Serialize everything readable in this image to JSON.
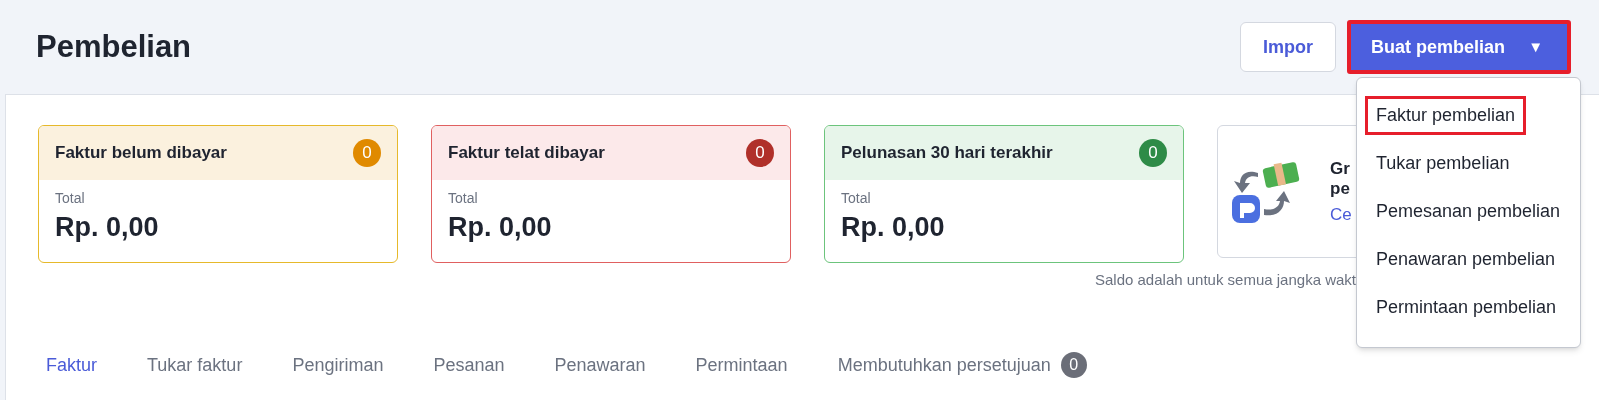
{
  "page_title": "Pembelian",
  "actions": {
    "import_button": "Impor",
    "create_button": {
      "label": "Buat pembelian",
      "caret": "▼",
      "expanded": true,
      "highlighted": true
    }
  },
  "create_menu": [
    {
      "label": "Faktur pembelian",
      "highlighted": true
    },
    {
      "label": "Tukar pembelian",
      "highlighted": false
    },
    {
      "label": "Pemesanan pembelian",
      "highlighted": false
    },
    {
      "label": "Penawaran pembelian",
      "highlighted": false
    },
    {
      "label": "Permintaan pembelian",
      "highlighted": false
    }
  ],
  "summary_cards": [
    {
      "title": "Faktur belum dibayar",
      "count": "0",
      "color": "#e08a00",
      "label": "Total",
      "amount": "Rp. 0,00"
    },
    {
      "title": "Faktur telat dibayar",
      "count": "0",
      "color": "#b0302a",
      "label": "Total",
      "amount": "Rp. 0,00"
    },
    {
      "title": "Pelunasan 30 hari terakhir",
      "count": "0",
      "color": "#2e8b47",
      "label": "Total",
      "amount": "Rp. 0,00"
    }
  ],
  "promo_card": {
    "title_lines": [
      "Gr",
      "pe"
    ],
    "link": "Ce"
  },
  "balance_note": "Saldo adalah untuk semua jangka wakt",
  "tabs": [
    {
      "label": "Faktur",
      "selected": true
    },
    {
      "label": "Tukar faktur",
      "selected": false
    },
    {
      "label": "Pengiriman",
      "selected": false
    },
    {
      "label": "Pesanan",
      "selected": false
    },
    {
      "label": "Penawaran",
      "selected": false
    },
    {
      "label": "Permintaan",
      "selected": false
    },
    {
      "label": "Membutuhkan persetujuan",
      "selected": false,
      "count": "0"
    }
  ]
}
